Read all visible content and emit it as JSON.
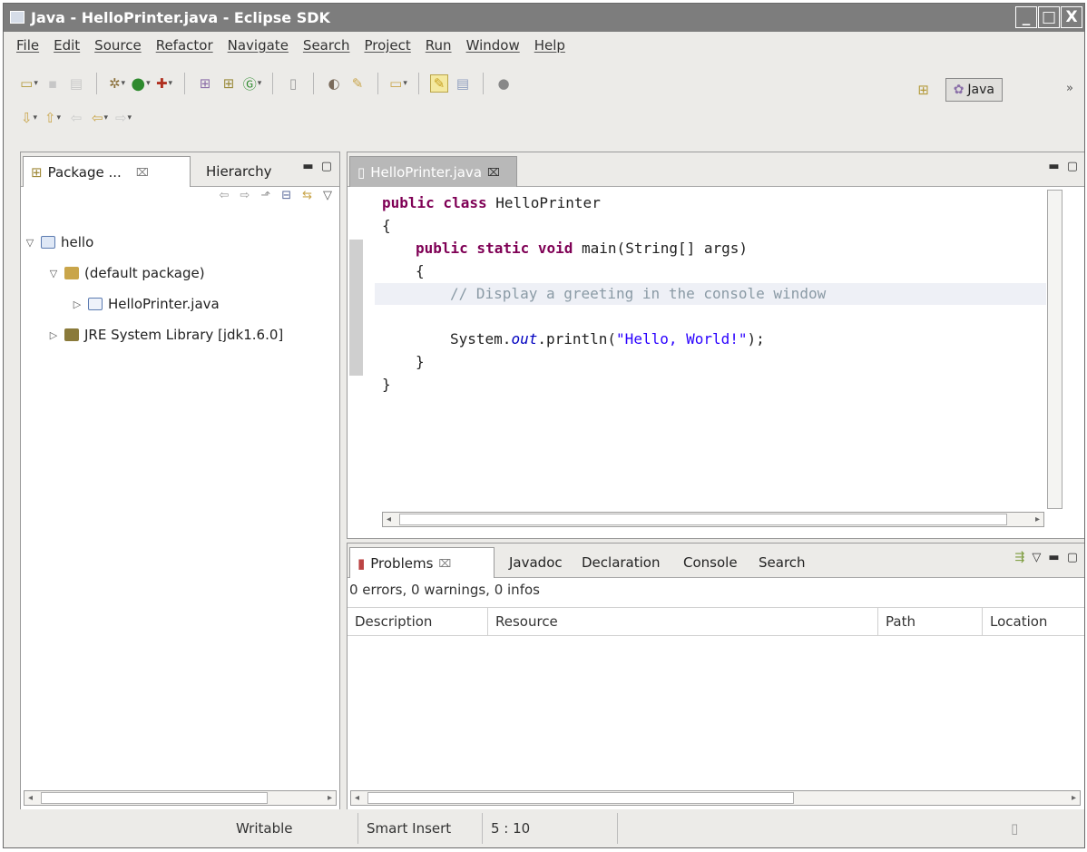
{
  "window": {
    "title": "Java - HelloPrinter.java - Eclipse SDK",
    "controls": [
      "_",
      "□",
      "X"
    ]
  },
  "menu": [
    "File",
    "Edit",
    "Source",
    "Refactor",
    "Navigate",
    "Search",
    "Project",
    "Run",
    "Window",
    "Help"
  ],
  "perspective": {
    "label": "Java",
    "more": "»"
  },
  "package_explorer": {
    "tabs": {
      "active": "Package ...",
      "other": "Hierarchy"
    },
    "tree": [
      {
        "label": "hello",
        "depth": 0,
        "expanded": true,
        "icon": "project-icon"
      },
      {
        "label": "(default package)",
        "depth": 1,
        "expanded": true,
        "icon": "package-icon"
      },
      {
        "label": "HelloPrinter.java",
        "depth": 2,
        "expanded": false,
        "icon": "java-file-icon"
      },
      {
        "label": "JRE System Library [jdk1.6.0]",
        "depth": 1,
        "expanded": false,
        "icon": "library-icon"
      }
    ]
  },
  "editor": {
    "tab": "HelloPrinter.java",
    "lines": {
      "l1a": "public class",
      "l1b": " HelloPrinter",
      "l2": "{",
      "l3a": "public static void",
      "l3b": " main(String[] args)",
      "l4": "{",
      "l5": "// Display a greeting in the console window",
      "l6a": "System.",
      "l6b": "out",
      "l6c": ".println(",
      "l6d": "\"Hello, World!\"",
      "l6e": ");",
      "l7": "}",
      "l8": "}"
    }
  },
  "problems": {
    "tabs": [
      "Problems",
      "Javadoc",
      "Declaration",
      "Console",
      "Search"
    ],
    "summary": "0 errors, 0 warnings, 0 infos",
    "columns": [
      "Description",
      "Resource",
      "Path",
      "Location"
    ]
  },
  "status": {
    "mode": "Writable",
    "insert": "Smart Insert",
    "position": "5 : 10"
  }
}
